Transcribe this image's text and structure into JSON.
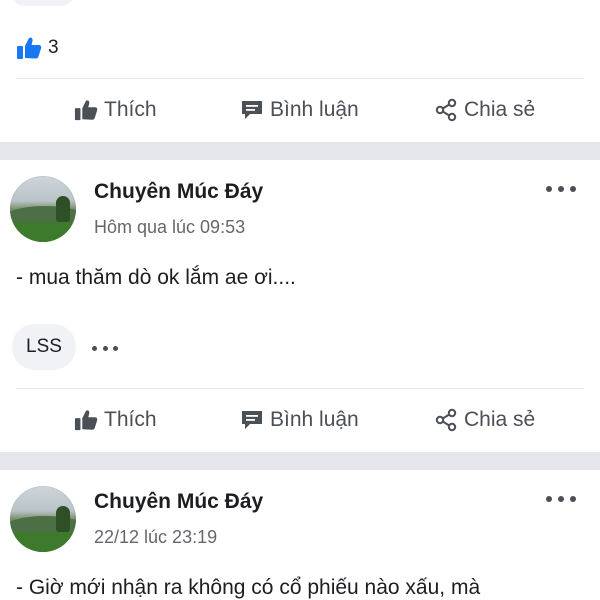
{
  "top_post": {
    "reaction_count": "3",
    "actions": {
      "like": "Thích",
      "comment": "Bình luận",
      "share": "Chia sẻ"
    }
  },
  "posts": [
    {
      "author": "Chuyên Múc Đáy",
      "timestamp": "Hôm qua lúc 09:53",
      "text": "- mua thăm dò ok lắm ae ơi....",
      "tag": "LSS",
      "actions": {
        "like": "Thích",
        "comment": "Bình luận",
        "share": "Chia sẻ"
      }
    },
    {
      "author": "Chuyên Múc Đáy",
      "timestamp": "22/12 lúc 23:19",
      "text": "- Giờ mới nhận ra không có cổ phiếu nào xấu, mà"
    }
  ],
  "colors": {
    "accent_blue": "#1877f2",
    "separator": "#e4e6eb",
    "secondary_text": "#65676b",
    "icon_gray": "#4b4f56"
  },
  "icons": {
    "like_badge": "thumbs-up-icon",
    "like": "thumbs-up-icon",
    "comment": "comment-icon",
    "share": "share-icon",
    "more": "more-horizontal-icon"
  }
}
